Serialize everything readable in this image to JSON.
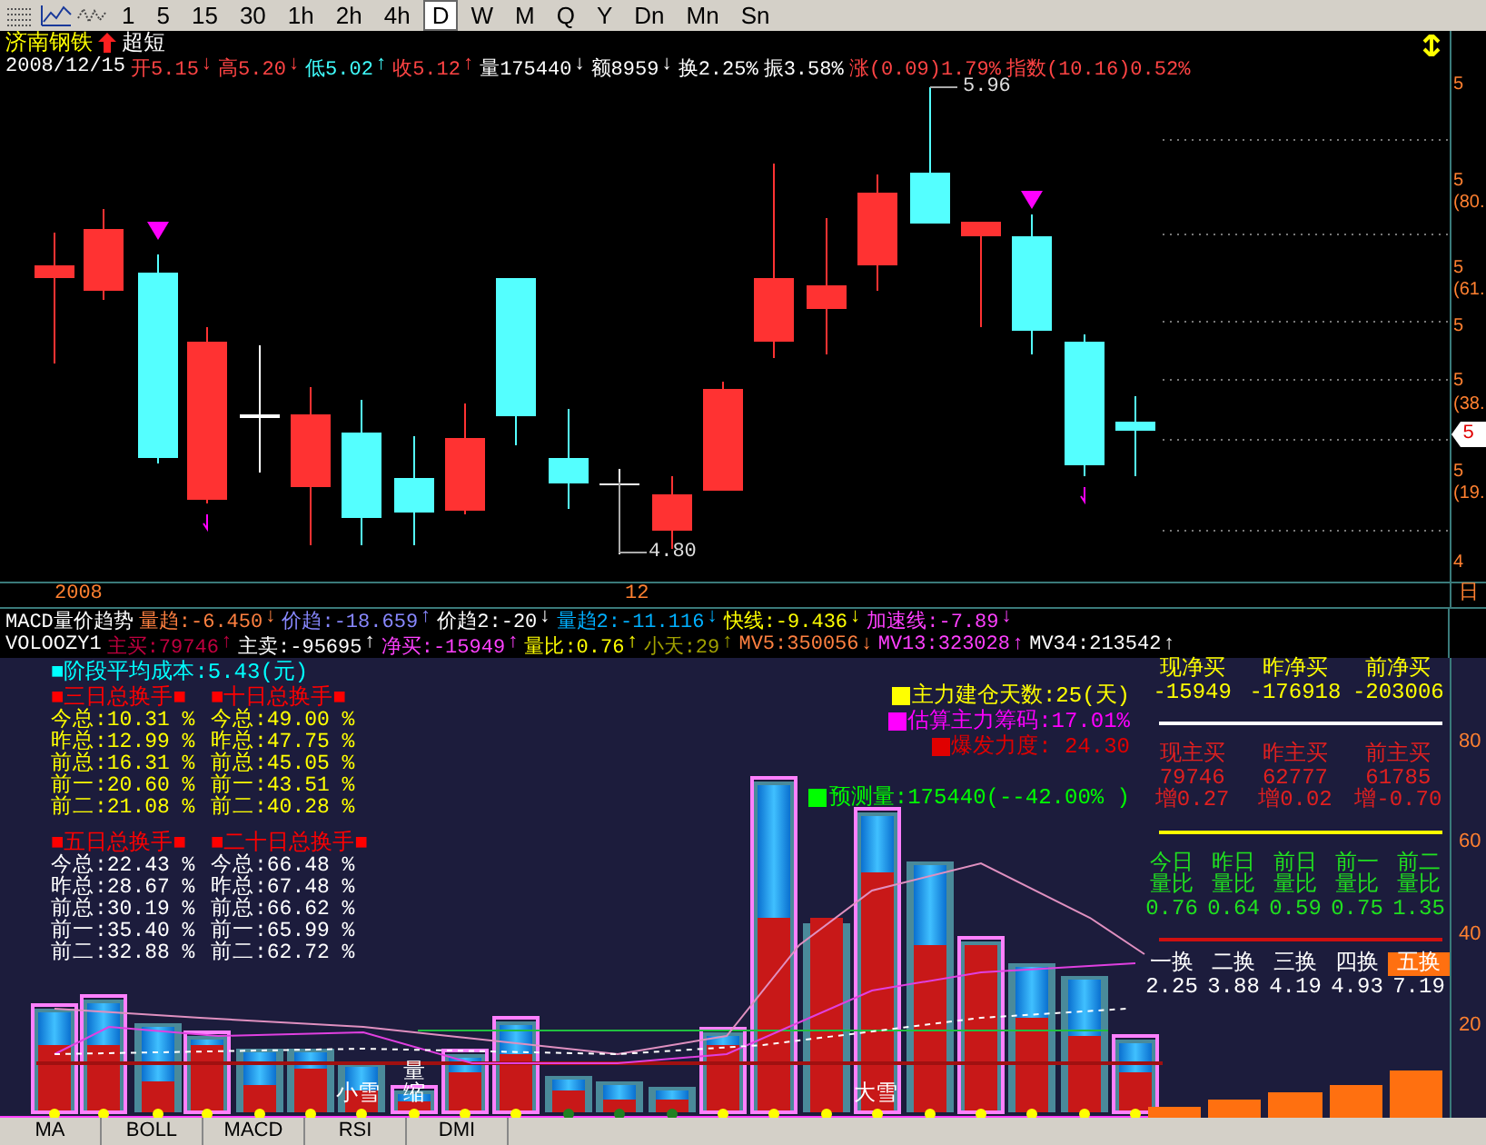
{
  "toolbar": {
    "periods": [
      {
        "label": "1",
        "selected": false
      },
      {
        "label": "5",
        "selected": false
      },
      {
        "label": "15",
        "selected": false
      },
      {
        "label": "30",
        "selected": false
      },
      {
        "label": "1h",
        "selected": false
      },
      {
        "label": "2h",
        "selected": false
      },
      {
        "label": "4h",
        "selected": false
      },
      {
        "label": "D",
        "selected": true
      },
      {
        "label": "W",
        "selected": false
      },
      {
        "label": "M",
        "selected": false
      },
      {
        "label": "Q",
        "selected": false
      },
      {
        "label": "Y",
        "selected": false
      },
      {
        "label": "Dn",
        "selected": false
      },
      {
        "label": "Mn",
        "selected": false
      },
      {
        "label": "Sn",
        "selected": false
      }
    ]
  },
  "stock": {
    "name": "济南钢铁",
    "mode": "超短"
  },
  "quote": [
    {
      "text": "2008/12/15",
      "color": "#ffffff"
    },
    {
      "text": "开5.15",
      "color": "#ff4444",
      "arrow": "↓"
    },
    {
      "text": "高5.20",
      "color": "#ff4444",
      "arrow": "↓"
    },
    {
      "text": "低5.02",
      "color": "#40ffff",
      "arrow": "↑"
    },
    {
      "text": "收5.12",
      "color": "#ff4444",
      "arrow": "↑"
    },
    {
      "text": "量175440",
      "color": "#ffffff",
      "arrow": "↓"
    },
    {
      "text": "额8959",
      "color": "#ffffff",
      "arrow": "↓"
    },
    {
      "text": "换2.25%",
      "color": "#ffffff"
    },
    {
      "text": "振3.58%",
      "color": "#ffffff"
    },
    {
      "text": "涨(0.09)1.79%",
      "color": "#ff4444"
    },
    {
      "text": "指数(10.16)0.52%",
      "color": "#ff4444"
    }
  ],
  "price_chart": {
    "high_label": "5.96",
    "low_label": "4.80",
    "axis_labels": [
      "5",
      "5",
      "(80.",
      "5",
      "(61.",
      "5",
      "5",
      "(38.",
      "5",
      "(19.",
      "4"
    ],
    "price_tag": "5"
  },
  "date_axis": {
    "labels": [
      "2008",
      "12"
    ],
    "period": "日"
  },
  "indicators": [
    {
      "name": "MACD量价趋势",
      "items": [
        {
          "text": "量趋:-6.450",
          "color": "#ff8040",
          "arrow": "↓"
        },
        {
          "text": "价趋:-18.659",
          "color": "#8888ff",
          "arrow": "↑"
        },
        {
          "text": "价趋2:-20",
          "color": "#ffffff",
          "arrow": "↓"
        },
        {
          "text": "量趋2:-11.116",
          "color": "#00b0ff",
          "arrow": "↓"
        },
        {
          "text": "快线:-9.436",
          "color": "#ffff00",
          "arrow": "↓"
        },
        {
          "text": "加速线:-7.89",
          "color": "#ff40ff",
          "arrow": "↓"
        }
      ]
    },
    {
      "name": "VOLOOZY1",
      "items": [
        {
          "text": "主买:79746",
          "color": "#c00040",
          "arrow": "↑"
        },
        {
          "text": "主卖:-95695",
          "color": "#ffffff",
          "arrow": "↑"
        },
        {
          "text": "净买:-15949",
          "color": "#ff40ff",
          "arrow": "↑"
        },
        {
          "text": "量比:0.76",
          "color": "#ffff00",
          "arrow": "↑"
        },
        {
          "text": "小天:29",
          "color": "#a0a000",
          "arrow": "↑"
        },
        {
          "text": "MV5:350056",
          "color": "#ff8040",
          "arrow": "↓"
        },
        {
          "text": "MV13:323028",
          "color": "#ff40ff",
          "arrow": "↑"
        },
        {
          "text": "MV34:213542",
          "color": "#ffffff",
          "arrow": "↑"
        }
      ]
    }
  ],
  "lower_panel": {
    "cost": "■阶段平均成本:5.43(元)",
    "turnover_groups": [
      {
        "title": "■三日总换手■",
        "color": "#ffff00",
        "rows": [
          "今总:10.31 %",
          "昨总:12.99 %",
          "前总:16.31 %",
          "前一:20.60 %",
          "前二:21.08 %"
        ]
      },
      {
        "title": "■十日总换手■",
        "color": "#ffff00",
        "rows": [
          "今总:49.00 %",
          "昨总:47.75 %",
          "前总:45.05 %",
          "前一:43.51 %",
          "前二:40.28 %"
        ]
      },
      {
        "title": "■五日总换手■",
        "color": "#ffffff",
        "rows": [
          "今总:22.43 %",
          "昨总:28.67 %",
          "前总:30.19 %",
          "前一:35.40 %",
          "前二:32.88 %"
        ]
      },
      {
        "title": "■二十日总换手■",
        "color": "#ffffff",
        "rows": [
          "今总:66.48 %",
          "昨总:67.48 %",
          "前总:66.62 %",
          "前一:65.99 %",
          "前二:62.72 %"
        ]
      }
    ],
    "main_force": [
      {
        "text": "主力建仓天数:25(天)",
        "color": "#ffff00"
      },
      {
        "text": "估算主力筹码:17.01%",
        "color": "#ff00ff"
      },
      {
        "text": "爆发力度: 24.30",
        "color": "#e00000"
      },
      {
        "text": "预测量:175440(--42.00% )",
        "color": "#00ff00"
      }
    ],
    "chart_labels": [
      "小雪",
      "量",
      "缩",
      "大雪"
    ],
    "net_buy": [
      {
        "label": "现净买",
        "value": "-15949"
      },
      {
        "label": "昨净买",
        "value": "-176918"
      },
      {
        "label": "前净买",
        "value": "-203006"
      }
    ],
    "main_buy": [
      {
        "label": "现主买",
        "value": "79746",
        "change": "增0.27"
      },
      {
        "label": "昨主买",
        "value": "62777",
        "change": "增0.02"
      },
      {
        "label": "前主买",
        "value": "61785",
        "change": "增-0.70"
      }
    ],
    "volume_ratio": [
      {
        "day": "今日",
        "label": "量比",
        "value": "0.76"
      },
      {
        "day": "昨日",
        "label": "量比",
        "value": "0.64"
      },
      {
        "day": "前日",
        "label": "量比",
        "value": "0.59"
      },
      {
        "day": "前一",
        "label": "量比",
        "value": "0.75"
      },
      {
        "day": "前二",
        "label": "量比",
        "value": "1.35"
      }
    ],
    "turnover": [
      {
        "label": "一换",
        "value": "2.25",
        "highlighted": false
      },
      {
        "label": "二换",
        "value": "3.88",
        "highlighted": false
      },
      {
        "label": "三换",
        "value": "4.19",
        "highlighted": false
      },
      {
        "label": "四换",
        "value": "4.93",
        "highlighted": false
      },
      {
        "label": "五换",
        "value": "7.19",
        "highlighted": true
      }
    ],
    "axis_labels": [
      "80",
      "60",
      "40",
      "20"
    ]
  },
  "bottom_tabs": [
    {
      "label": "MA",
      "selected": false
    },
    {
      "label": "BOLL",
      "selected": false
    },
    {
      "label": "MACD",
      "selected": false
    },
    {
      "label": "RSI",
      "selected": false
    },
    {
      "label": "DMI",
      "selected": false
    }
  ]
}
